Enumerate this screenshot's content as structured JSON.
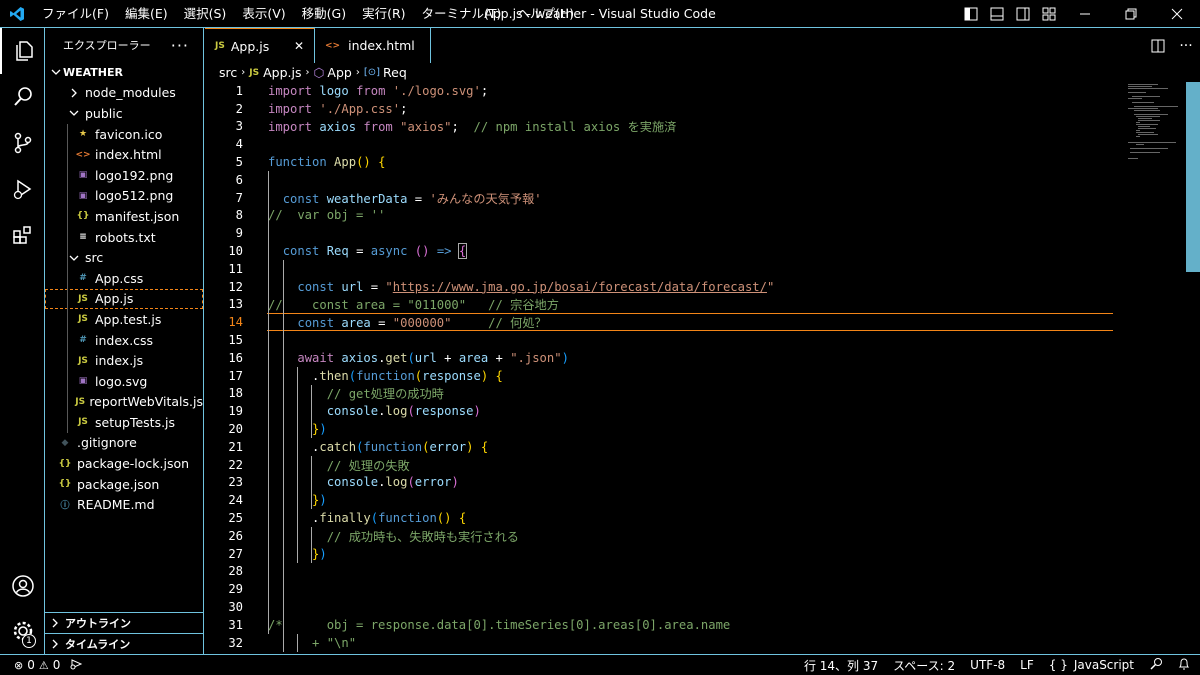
{
  "window": {
    "title": "App.js - weather - Visual Studio Code",
    "menus": [
      "ファイル(F)",
      "編集(E)",
      "選択(S)",
      "表示(V)",
      "移動(G)",
      "実行(R)",
      "ターミナル(T)",
      "ヘルプ(H)"
    ]
  },
  "sidebar": {
    "title": "エクスプローラー",
    "more": "···",
    "root": "WEATHER",
    "items": [
      {
        "label": "node_modules",
        "icon": "chevron-right-icon",
        "glyph": "",
        "color": "#fff"
      },
      {
        "label": "public",
        "icon": "chevron-down-icon",
        "glyph": "",
        "color": "#fff"
      },
      {
        "label": "favicon.ico",
        "icon": "star-icon",
        "glyph": "★",
        "color": "#e8c94b"
      },
      {
        "label": "index.html",
        "icon": "html-icon",
        "glyph": "<>",
        "color": "#e37933"
      },
      {
        "label": "logo192.png",
        "icon": "image-icon",
        "glyph": "▣",
        "color": "#a074c4"
      },
      {
        "label": "logo512.png",
        "icon": "image-icon",
        "glyph": "▣",
        "color": "#a074c4"
      },
      {
        "label": "manifest.json",
        "icon": "json-icon",
        "glyph": "{}",
        "color": "#cbcb41"
      },
      {
        "label": "robots.txt",
        "icon": "text-file-icon",
        "glyph": "≡",
        "color": "#fff"
      },
      {
        "label": "src",
        "icon": "chevron-down-icon",
        "glyph": "",
        "color": "#fff"
      },
      {
        "label": "App.css",
        "icon": "css-icon",
        "glyph": "#",
        "color": "#519aba"
      },
      {
        "label": "App.js",
        "icon": "js-icon",
        "glyph": "JS",
        "color": "#cbcb41"
      },
      {
        "label": "App.test.js",
        "icon": "js-icon",
        "glyph": "JS",
        "color": "#cbcb41"
      },
      {
        "label": "index.css",
        "icon": "css-icon",
        "glyph": "#",
        "color": "#519aba"
      },
      {
        "label": "index.js",
        "icon": "js-icon",
        "glyph": "JS",
        "color": "#cbcb41"
      },
      {
        "label": "logo.svg",
        "icon": "image-icon",
        "glyph": "▣",
        "color": "#a074c4"
      },
      {
        "label": "reportWebVitals.js",
        "icon": "js-icon",
        "glyph": "JS",
        "color": "#cbcb41"
      },
      {
        "label": "setupTests.js",
        "icon": "js-icon",
        "glyph": "JS",
        "color": "#cbcb41"
      },
      {
        "label": ".gitignore",
        "icon": "git-icon",
        "glyph": "◆",
        "color": "#41535b"
      },
      {
        "label": "package-lock.json",
        "icon": "json-icon",
        "glyph": "{}",
        "color": "#cbcb41"
      },
      {
        "label": "package.json",
        "icon": "json-icon",
        "glyph": "{}",
        "color": "#cbcb41"
      },
      {
        "label": "README.md",
        "icon": "info-icon",
        "glyph": "ⓘ",
        "color": "#519aba"
      }
    ],
    "outline": "アウトライン",
    "timeline": "タイムライン"
  },
  "tabs": [
    {
      "label": "App.js",
      "badge": "JS",
      "close": "✕"
    },
    {
      "label": "index.html",
      "badge": "<>"
    }
  ],
  "breadcrumb": {
    "folder": "src",
    "file": "App.js",
    "func": "App",
    "symbol": "Req",
    "file_badge": "JS"
  },
  "editor": {
    "lines": [
      "1",
      "2",
      "3",
      "4",
      "5",
      "6",
      "7",
      "8",
      "9",
      "10",
      "11",
      "12",
      "13",
      "14",
      "15",
      "16",
      "17",
      "18",
      "19",
      "20",
      "21",
      "22",
      "23",
      "24",
      "25",
      "26",
      "27",
      "28",
      "29",
      "30",
      "31",
      "32"
    ],
    "current_line": "14"
  },
  "status": {
    "errors": "0",
    "warnings": "0",
    "position": "行 14、列 37",
    "spaces": "スペース: 2",
    "encoding": "UTF-8",
    "eol": "LF",
    "language": "JavaScript",
    "badge": "1"
  }
}
